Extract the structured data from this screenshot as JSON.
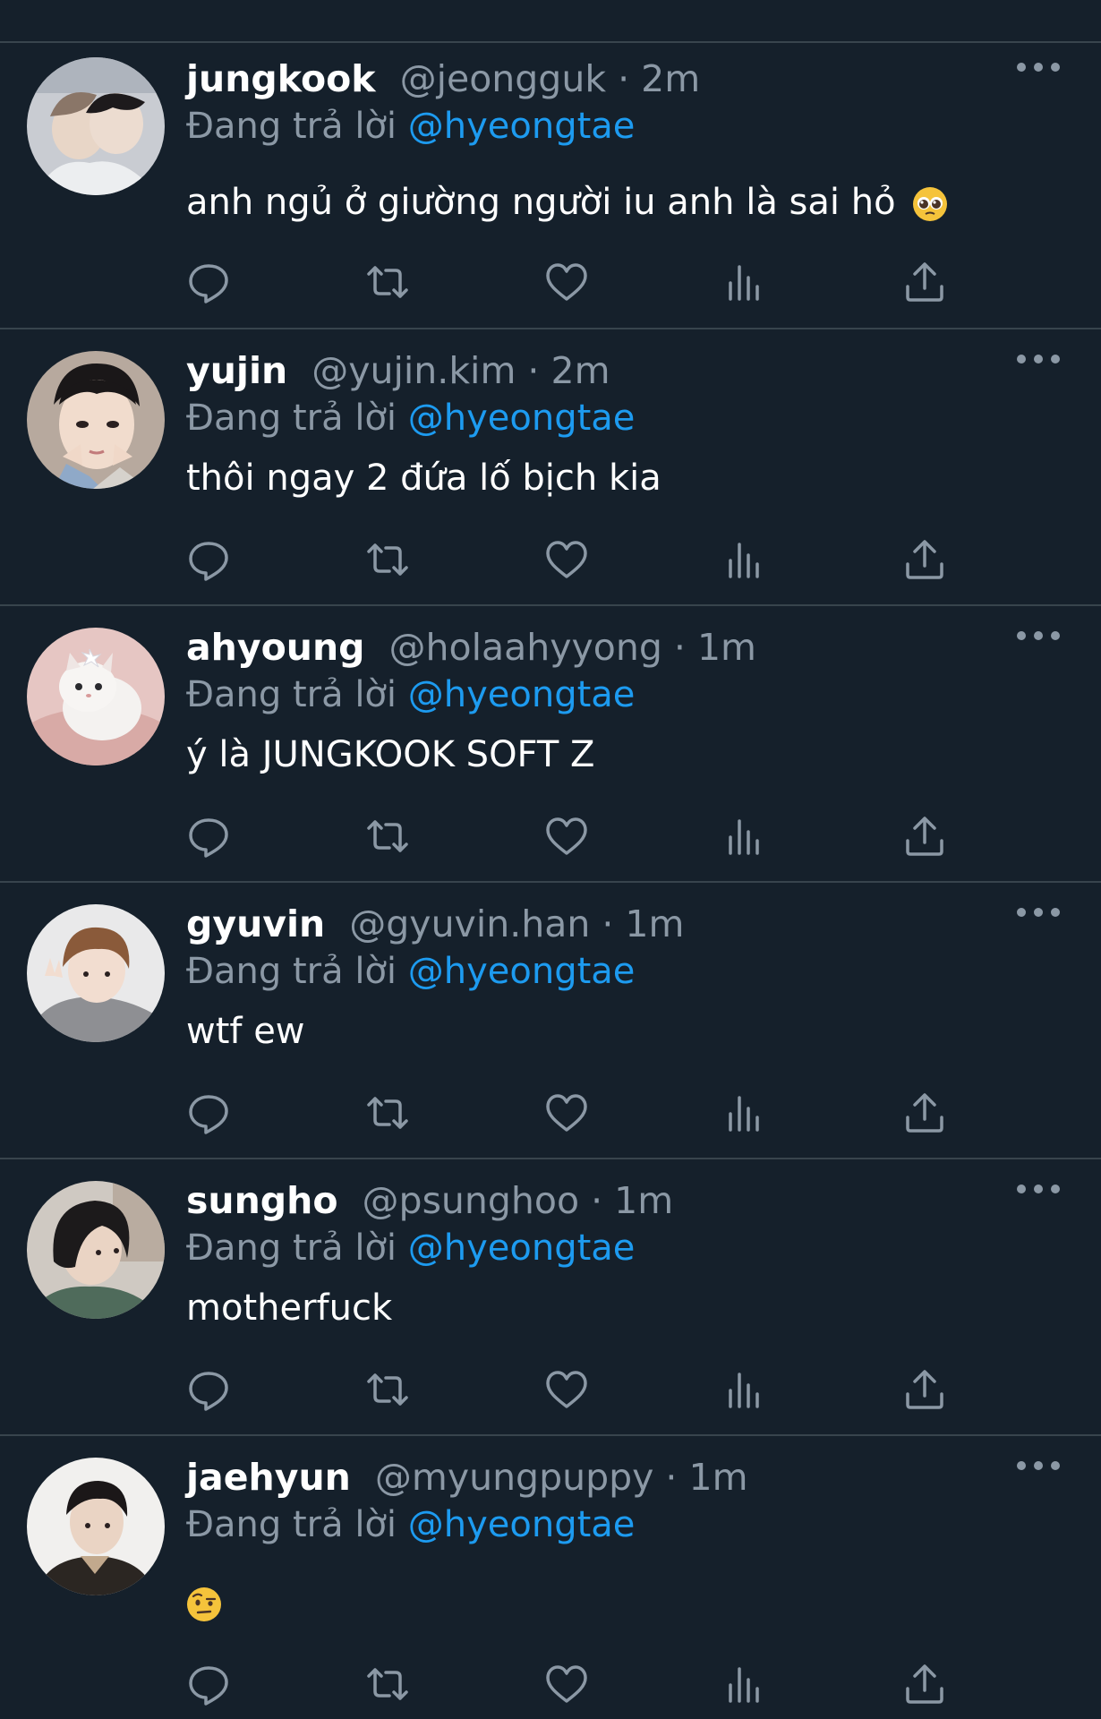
{
  "reply_prefix": "Đang trả lời",
  "colors": {
    "background": "#15202b",
    "divider": "#38444d",
    "muted": "#8b98a5",
    "accent": "#1d9bf0"
  },
  "actions": [
    "reply-icon",
    "retweet-icon",
    "like-icon",
    "views-icon",
    "share-icon"
  ],
  "tweets": [
    {
      "name": "jungkook",
      "meta": "@jeongguk · 2m",
      "mention": "@hyeongtae",
      "text": "anh ngủ ở giường người iu anh là sai hỏ",
      "emoji": "pleading-face"
    },
    {
      "name": "yujin",
      "meta": "@yujin.kim · 2m",
      "mention": "@hyeongtae",
      "text": "thôi ngay 2 đứa lố bịch kia"
    },
    {
      "name": "ahyoung",
      "meta": "@holaahyyong · 1m",
      "mention": "@hyeongtae",
      "text": "ý là JUNGKOOK SOFT Z"
    },
    {
      "name": "gyuvin",
      "meta": "@gyuvin.han · 1m",
      "mention": "@hyeongtae",
      "text": "wtf ew"
    },
    {
      "name": "sungho",
      "meta": "@psunghoo · 1m",
      "mention": "@hyeongtae",
      "text": "motherfuck"
    },
    {
      "name": "jaehyun",
      "meta": "@myungpuppy · 1m",
      "mention": "@hyeongtae",
      "text": "",
      "emoji": "face-with-raised-eyebrow"
    }
  ]
}
